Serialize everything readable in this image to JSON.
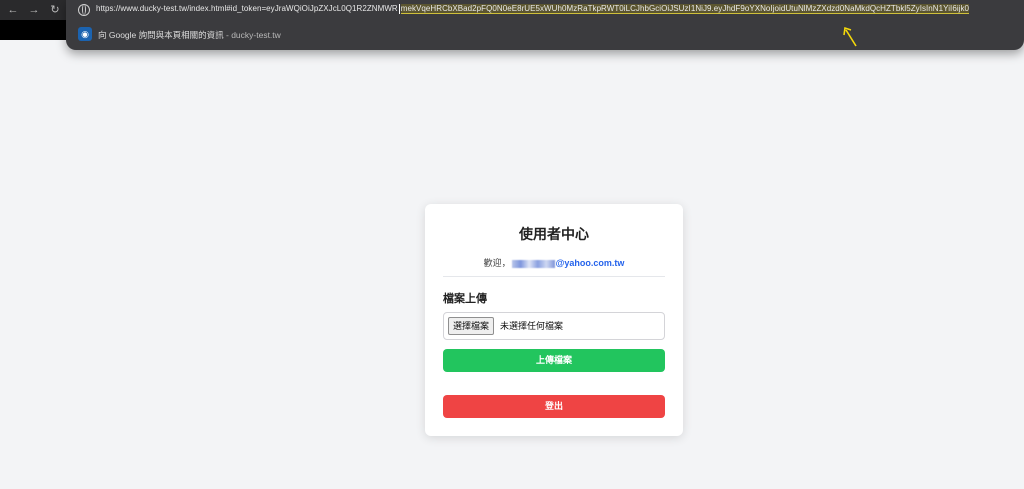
{
  "browser": {
    "url_host": "https://www.ducky-test.tw",
    "url_path": "/index.html#id_token=eyJraWQiOiJpZXJcL0Q1R2ZNMWR",
    "url_selected": "mekVqeHRCbXBad2pFQ0N0eE8rUE5xWUh0MzRaTkpRWT0iLCJhbGciOiJSUzI1NiJ9.eyJhdF9oYXNoIjoidUtuNlMzZXdzd0NaMkdQcHZTbkl5ZyIsInN1YiI6ijk0",
    "suggestion_text": "向 Google 詢問與本頁相關的資訊",
    "suggestion_sub": " - ducky-test.tw",
    "annotation_color": "#f5d90a"
  },
  "card": {
    "title": "使用者中心",
    "welcome_prefix": "歡迎，",
    "email_suffix": "@yahoo.com.tw",
    "section_title": "檔案上傳",
    "file_button": "選擇檔案",
    "file_status": "未選擇任何檔案",
    "upload_button": "上傳檔案",
    "logout_button": "登出"
  },
  "colors": {
    "upload": "#22c55e",
    "logout": "#ef4444",
    "email": "#2563eb"
  }
}
